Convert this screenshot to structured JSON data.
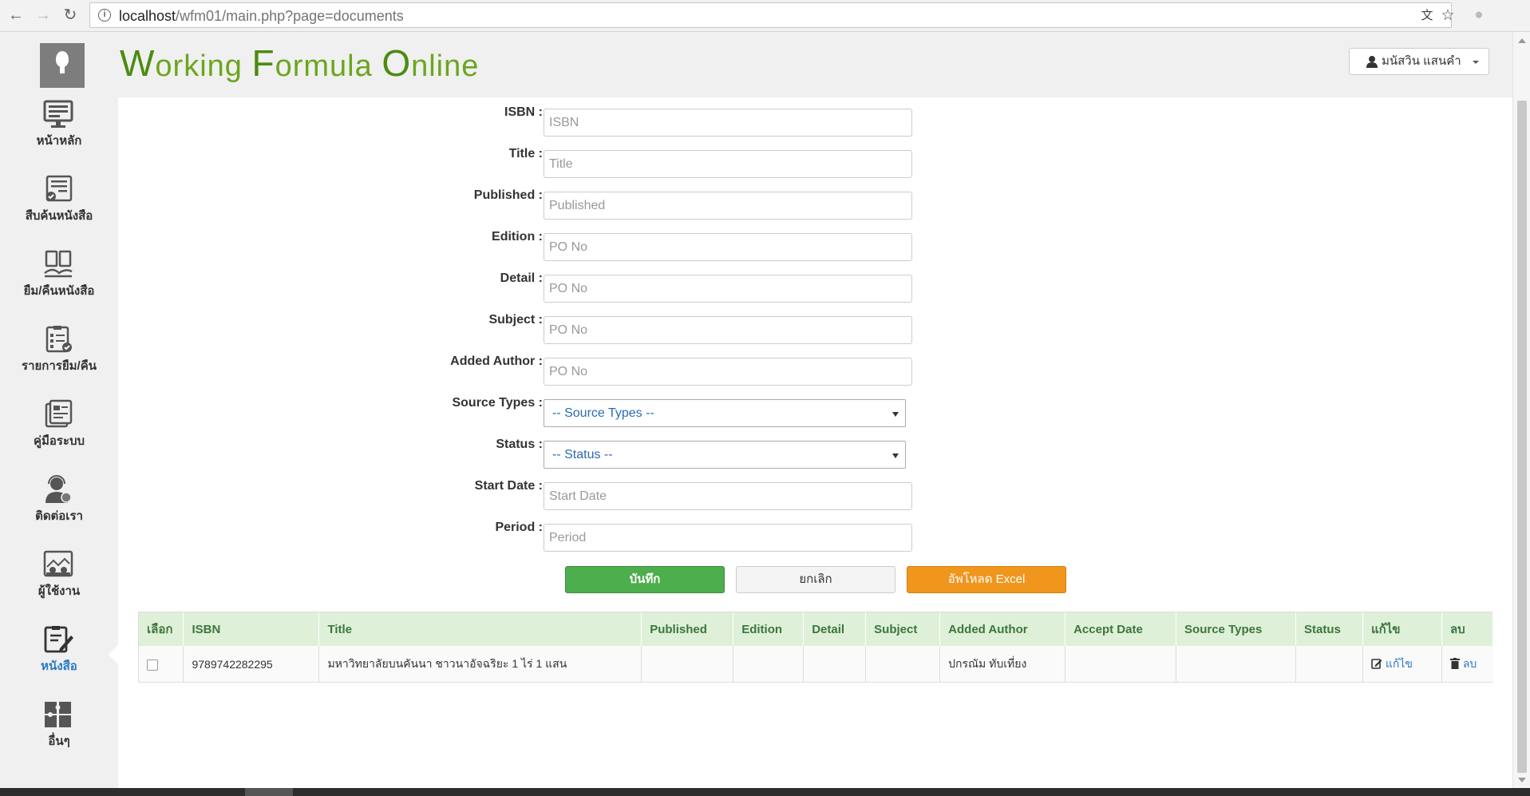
{
  "browser": {
    "url_host": "localhost",
    "url_path": "/wfm01/main.php?page=documents"
  },
  "app": {
    "logo_parts": [
      {
        "text": "W",
        "big": true
      },
      {
        "text": "orki",
        "big": false
      },
      {
        "text": "n",
        "big": false
      },
      {
        "text": "g ",
        "big": false
      },
      {
        "text": "F",
        "big": true
      },
      {
        "text": "ormula ",
        "big": false
      },
      {
        "text": "O",
        "big": true
      },
      {
        "text": "nli",
        "big": false
      },
      {
        "text": "ne",
        "big": false
      }
    ],
    "user_name": "มนัสวิน แสนคำ",
    "accent_color": "#2a7ac3",
    "header_bg": "#f0f0f0"
  },
  "sidebar": {
    "items": [
      {
        "label": "หน้าหลัก",
        "icon": "monitor-icon",
        "active": false
      },
      {
        "label": "สืบค้นหนังสือ",
        "icon": "search-book-icon",
        "active": false
      },
      {
        "label": "ยืม/คืนหนังสือ",
        "icon": "borrow-return-icon",
        "active": false
      },
      {
        "label": "รายการยืม/คืน",
        "icon": "checklist-icon",
        "active": false
      },
      {
        "label": "คู่มือระบบ",
        "icon": "manual-icon",
        "active": false
      },
      {
        "label": "ติดต่อเรา",
        "icon": "support-agent-icon",
        "active": false
      },
      {
        "label": "ผู้ใช้งาน",
        "icon": "users-icon",
        "active": false
      },
      {
        "label": "หนังสือ",
        "icon": "book-edit-icon",
        "active": true
      },
      {
        "label": "อื่นๆ",
        "icon": "puzzle-icon",
        "active": false
      }
    ]
  },
  "form": {
    "fields": [
      {
        "label": "ISBN :",
        "placeholder": "ISBN",
        "type": "input"
      },
      {
        "label": "Title :",
        "placeholder": "Title",
        "type": "input"
      },
      {
        "label": "Published :",
        "placeholder": "Published",
        "type": "input"
      },
      {
        "label": "Edition :",
        "placeholder": "PO No",
        "type": "input"
      },
      {
        "label": "Detail :",
        "placeholder": "PO No",
        "type": "input"
      },
      {
        "label": "Subject :",
        "placeholder": "PO No",
        "type": "input"
      },
      {
        "label": "Added Author :",
        "placeholder": "PO No",
        "type": "input"
      },
      {
        "label": "Source Types :",
        "placeholder": "-- Source Types --",
        "type": "select"
      },
      {
        "label": "Status :",
        "placeholder": "-- Status --",
        "type": "select"
      },
      {
        "label": "Start Date :",
        "placeholder": "Start Date",
        "type": "input"
      },
      {
        "label": "Period :",
        "placeholder": "Period",
        "type": "input"
      }
    ],
    "save_label": "บันทึก",
    "cancel_label": "ยกเลิก",
    "excel_label": "อัพโหลด Excel"
  },
  "table": {
    "headers": [
      "เลือก",
      "ISBN",
      "Title",
      "Published",
      "Edition",
      "Detail",
      "Subject",
      "Added Author",
      "Accept Date",
      "Source Types",
      "Status",
      "แก้ไข",
      "ลบ"
    ],
    "rows": [
      {
        "isbn": "9789742282295",
        "title": "มหาวิทยาลัยบนคันนา ชาวนาอัจฉริยะ 1 ไร่ 1 แสน",
        "published": "",
        "edition": "",
        "detail": "",
        "subject": "",
        "added_author": "ปกรณัม ทับเที่ยง",
        "accept_date": "",
        "source_types": "",
        "status": "",
        "edit_label": "แก้ไข",
        "delete_label": "ลบ"
      }
    ]
  }
}
